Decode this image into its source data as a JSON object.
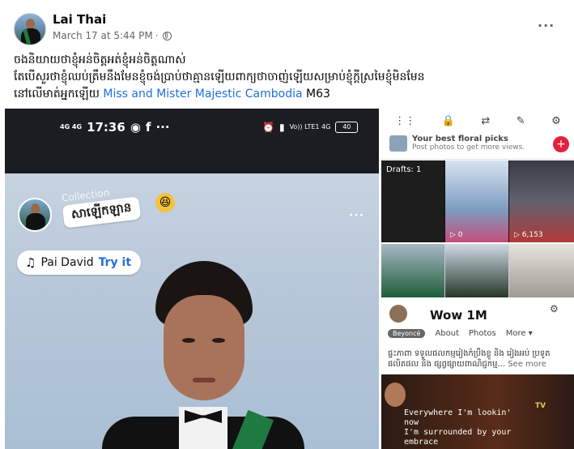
{
  "post": {
    "author": "Lai Thai",
    "timestamp": "March 17 at 5:44 PM",
    "separator": "·",
    "more_label": "···",
    "text_line1": "ចងនិយាយថាខ្ញុំអន់ចិត្តអត់ខ្ញុំអន់ចិត្តណាស់",
    "text_line2": "តែបើសួរថាខ្ញុំឈប់ត្រឹមនឹងមែនខ្ញុំចង់ប្រាប់ថាគ្មានឡើយពាក្យថាចាញ់ឡើយសម្រាប់ខ្ញុំក្តីស្រមៃខ្ញុំមិនមែន",
    "text_line3_prefix": "នៅលើមាត់អ្នកឡើយ",
    "link_text": "Miss and Mister Majestic Cambodia",
    "text_line3_suffix": "M63"
  },
  "story": {
    "time": "17:36",
    "net_left": "4G 4G",
    "battery": "40",
    "net_right": "Vo)) LTE1 4G",
    "sticker_text": "សាឡើកឡាន",
    "sticker_bg_text": "Collection",
    "dots": "···",
    "music_artist": "Pai David",
    "music_try": "Try it"
  },
  "right_panel": {
    "picks_title": "Your best floral picks",
    "picks_sub": "Post photos to get more views.",
    "plus": "+",
    "close": "✕",
    "drafts": "Drafts: 1",
    "count1": "▷ 0",
    "count2": "▷ 6,153",
    "wow": "Wow 1M",
    "beyonce": "Beyoncé",
    "tab_about": "About",
    "tab_photos": "Photos",
    "tab_more": "More ▾",
    "desc": "ផ្ទះភាពា ទទួលផលកម្មរៀងកំប្រឹងខ្លួ និង រៀងអប់ ប្រទូត ផលិតផល និង ផ្សព្វផ្សាយពាណិជ្ជកម្ម...",
    "see_more": "See more",
    "lyric1": "Everywhere I'm lookin'",
    "lyric2": "now",
    "lyric3": "I'm surrounded by your",
    "lyric4": "embrace",
    "tv": "TV"
  }
}
